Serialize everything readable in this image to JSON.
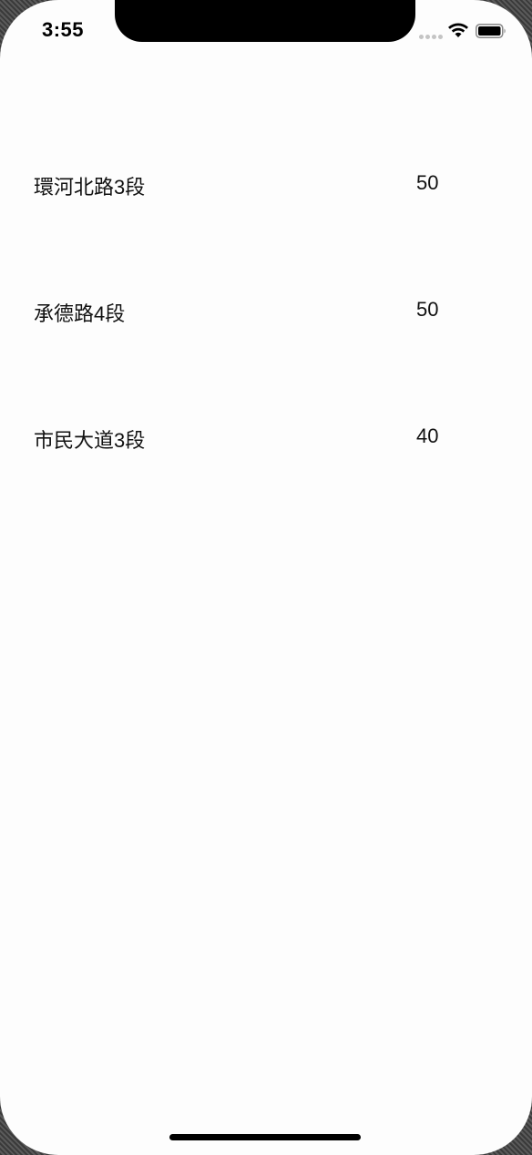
{
  "status_bar": {
    "time": "3:55",
    "signal_icon": "cellular-signal-icon",
    "wifi_icon": "wifi-icon",
    "battery_icon": "battery-icon"
  },
  "list": {
    "rows": [
      {
        "name": "環河北路3段",
        "value": "50"
      },
      {
        "name": "承德路4段",
        "value": "50"
      },
      {
        "name": "市民大道3段",
        "value": "40"
      }
    ]
  }
}
